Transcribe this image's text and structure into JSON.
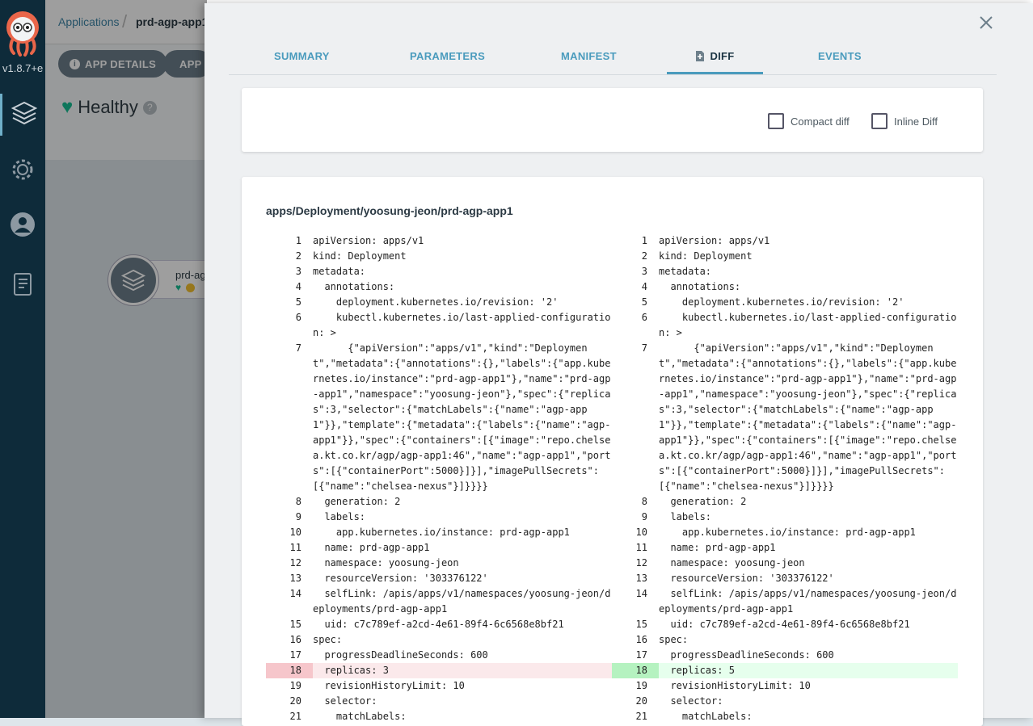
{
  "nav": {
    "version": "v1.8.7+e"
  },
  "breadcrumb": {
    "root": "Applications",
    "current": "prd-agp-app1"
  },
  "app": {
    "details_button": "APP DETAILS",
    "second_button": "APP",
    "health": "Healthy",
    "node_name": "prd-ag"
  },
  "tabs": [
    "SUMMARY",
    "PARAMETERS",
    "MANIFEST",
    "DIFF",
    "EVENTS"
  ],
  "options": {
    "compact_diff": "Compact diff",
    "inline_diff": "Inline Diff"
  },
  "resource": "apps/Deployment/yoosung-jeon/prd-agp-app1",
  "colors": {
    "accent": "#4a9bbd",
    "health_green": "#18be94",
    "removed_line": "#f6c6cb",
    "added_line": "#b5f2c0"
  },
  "diff": {
    "left": [
      {
        "n": "1",
        "t": "apiVersion: apps/v1"
      },
      {
        "n": "2",
        "t": "kind: Deployment"
      },
      {
        "n": "3",
        "t": "metadata:"
      },
      {
        "n": "4",
        "t": "  annotations:"
      },
      {
        "n": "5",
        "t": "    deployment.kubernetes.io/revision: '2'"
      },
      {
        "n": "6",
        "t": "    kubectl.kubernetes.io/last-applied-configuration: >"
      },
      {
        "n": "7",
        "t": "      {\"apiVersion\":\"apps/v1\",\"kind\":\"Deployment\",\"metadata\":{\"annotations\":{},\"labels\":{\"app.kubernetes.io/instance\":\"prd-agp-app1\"},\"name\":\"prd-agp-app1\",\"namespace\":\"yoosung-jeon\"},\"spec\":{\"replicas\":3,\"selector\":{\"matchLabels\":{\"name\":\"agp-app1\"}},\"template\":{\"metadata\":{\"labels\":{\"name\":\"agp-app1\"}},\"spec\":{\"containers\":[{\"image\":\"repo.chelsea.kt.co.kr/agp/agp-app1:46\",\"name\":\"agp-app1\",\"ports\":[{\"containerPort\":5000}]}],\"imagePullSecrets\":[{\"name\":\"chelsea-nexus\"}]}}}}"
      },
      {
        "n": "8",
        "t": "  generation: 2"
      },
      {
        "n": "9",
        "t": "  labels:"
      },
      {
        "n": "10",
        "t": "    app.kubernetes.io/instance: prd-agp-app1"
      },
      {
        "n": "11",
        "t": "  name: prd-agp-app1"
      },
      {
        "n": "12",
        "t": "  namespace: yoosung-jeon"
      },
      {
        "n": "13",
        "t": "  resourceVersion: '303376122'"
      },
      {
        "n": "14",
        "t": "  selfLink: /apis/apps/v1/namespaces/yoosung-jeon/deployments/prd-agp-app1"
      },
      {
        "n": "15",
        "t": "  uid: c7c789ef-a2cd-4e61-89f4-6c6568e8bf21"
      },
      {
        "n": "16",
        "t": "spec:"
      },
      {
        "n": "17",
        "t": "  progressDeadlineSeconds: 600"
      },
      {
        "n": "18",
        "t": "  replicas: 3",
        "k": "del"
      },
      {
        "n": "19",
        "t": "  revisionHistoryLimit: 10"
      },
      {
        "n": "20",
        "t": "  selector:"
      },
      {
        "n": "21",
        "t": "    matchLabels:"
      }
    ],
    "right": [
      {
        "n": "1",
        "t": "apiVersion: apps/v1"
      },
      {
        "n": "2",
        "t": "kind: Deployment"
      },
      {
        "n": "3",
        "t": "metadata:"
      },
      {
        "n": "4",
        "t": "  annotations:"
      },
      {
        "n": "5",
        "t": "    deployment.kubernetes.io/revision: '2'"
      },
      {
        "n": "6",
        "t": "    kubectl.kubernetes.io/last-applied-configuration: >"
      },
      {
        "n": "7",
        "t": "      {\"apiVersion\":\"apps/v1\",\"kind\":\"Deployment\",\"metadata\":{\"annotations\":{},\"labels\":{\"app.kubernetes.io/instance\":\"prd-agp-app1\"},\"name\":\"prd-agp-app1\",\"namespace\":\"yoosung-jeon\"},\"spec\":{\"replicas\":3,\"selector\":{\"matchLabels\":{\"name\":\"agp-app1\"}},\"template\":{\"metadata\":{\"labels\":{\"name\":\"agp-app1\"}},\"spec\":{\"containers\":[{\"image\":\"repo.chelsea.kt.co.kr/agp/agp-app1:46\",\"name\":\"agp-app1\",\"ports\":[{\"containerPort\":5000}]}],\"imagePullSecrets\":[{\"name\":\"chelsea-nexus\"}]}}}}"
      },
      {
        "n": "8",
        "t": "  generation: 2"
      },
      {
        "n": "9",
        "t": "  labels:"
      },
      {
        "n": "10",
        "t": "    app.kubernetes.io/instance: prd-agp-app1"
      },
      {
        "n": "11",
        "t": "  name: prd-agp-app1"
      },
      {
        "n": "12",
        "t": "  namespace: yoosung-jeon"
      },
      {
        "n": "13",
        "t": "  resourceVersion: '303376122'"
      },
      {
        "n": "14",
        "t": "  selfLink: /apis/apps/v1/namespaces/yoosung-jeon/deployments/prd-agp-app1"
      },
      {
        "n": "15",
        "t": "  uid: c7c789ef-a2cd-4e61-89f4-6c6568e8bf21"
      },
      {
        "n": "16",
        "t": "spec:"
      },
      {
        "n": "17",
        "t": "  progressDeadlineSeconds: 600"
      },
      {
        "n": "18",
        "t": "  replicas: 5",
        "k": "add"
      },
      {
        "n": "19",
        "t": "  revisionHistoryLimit: 10"
      },
      {
        "n": "20",
        "t": "  selector:"
      },
      {
        "n": "21",
        "t": "    matchLabels:"
      }
    ]
  }
}
